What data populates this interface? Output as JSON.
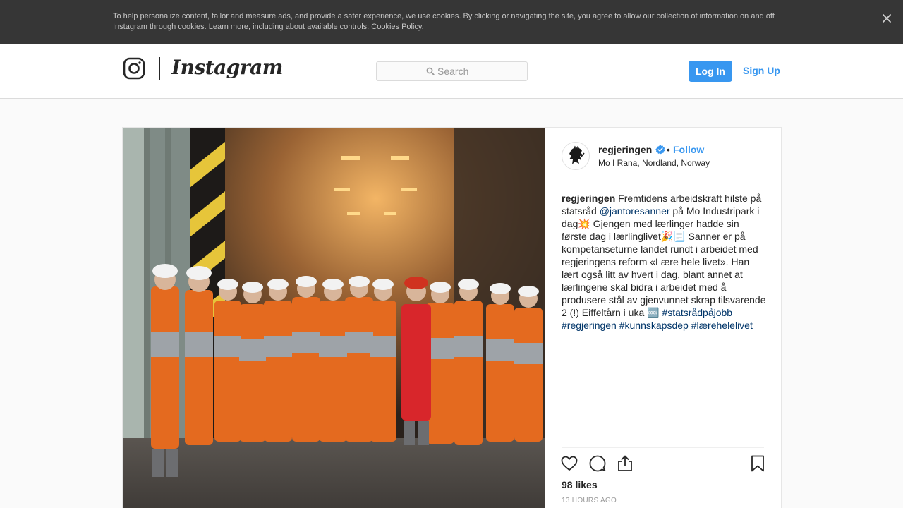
{
  "cookie_banner": {
    "text": "To help personalize content, tailor and measure ads, and provide a safer experience, we use cookies. By clicking or navigating the site, you agree to allow our collection of information on and off Instagram through cookies. Learn more, including about available controls: ",
    "link_label": "Cookies Policy",
    "trailing": ".",
    "close_icon": "close-icon"
  },
  "header": {
    "logo_icon": "instagram-camera-icon",
    "wordmark": "Instagram",
    "search_placeholder": "Search",
    "search_icon": "search-icon",
    "login_label": "Log In",
    "signup_label": "Sign Up"
  },
  "post": {
    "username": "regjeringen",
    "follow_label": "Follow",
    "location": "Mo I Rana, Nordland, Norway",
    "caption": {
      "username": "regjeringen",
      "part1": " Fremtidens arbeidskraft hilste på statsråd ",
      "mention": "@jantoresanner",
      "part2": " på Mo Industripark i dag💥 Gjengen med lærlinger hadde sin første dag i lærlinglivet🎉📃 Sanner er på kompetanseturne landet rundt i arbeidet med regjeringens reform «Lære hele livet». Han lært også litt av hvert i dag, blant annet at lærlingene skal bidra i arbeidet med å produsere stål av gjenvunnet skrap tilsvarende 2 (!) Eiffeltårn i uka 🆒 ",
      "hashtags": [
        "#statsrådpåjobb",
        "#regjeringen",
        "#kunnskapsdep",
        "#lærehelelivet"
      ]
    },
    "likes": "98 likes",
    "timestamp": "13 HOURS AGO",
    "accent_color": "#3897f0",
    "link_color": "#003569"
  }
}
